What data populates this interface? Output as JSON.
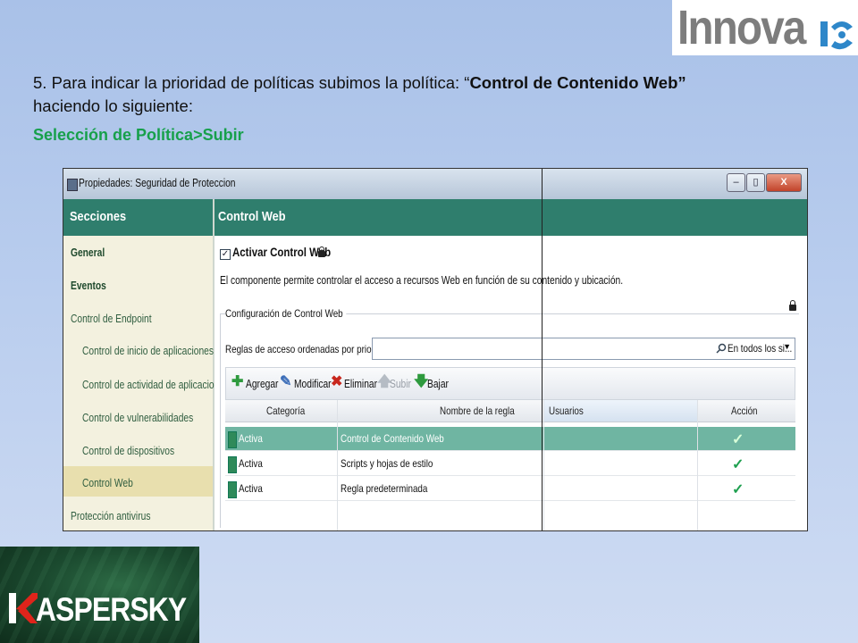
{
  "logo": {
    "text": "Innova"
  },
  "slide": {
    "intro": "5. Para indicar la prioridad de políticas subimos la política: “",
    "policy_name": "Control de Contenido Web",
    "intro_end": "”",
    "intro_line2": "haciendo lo siguiente:",
    "path": "Selección de Política>Subir"
  },
  "window": {
    "title": "Propiedades: Seguridad de Proteccion",
    "buttons": {
      "minimize": "–",
      "maximize": "▯",
      "close": "X"
    }
  },
  "sections": {
    "header": "Secciones",
    "items": [
      {
        "label": "General"
      },
      {
        "label": "Eventos"
      },
      {
        "label": "Control de Endpoint"
      },
      {
        "label": "Control de inicio de aplicaciones"
      },
      {
        "label": "Control de actividad de aplicaciones"
      },
      {
        "label": "Control de vulnerabilidades"
      },
      {
        "label": "Control de dispositivos"
      },
      {
        "label": "Control Web"
      },
      {
        "label": "Protección antivirus"
      }
    ],
    "selected": "Control Web"
  },
  "panel": {
    "header": "Control Web",
    "activate_label": "Activar Control Web",
    "activate_checked": true,
    "description": "El componente permite controlar el acceso a recursos Web en función de su contenido y ubicación.",
    "group_title": "Configuración de Control Web",
    "rules_label": "Reglas de acceso ordenadas por prioridad:",
    "search_scope": "En todos los si...",
    "toolbar": {
      "add": "Agregar",
      "edit": "Modificar",
      "delete": "Eliminar",
      "up": "Subir",
      "down": "Bajar"
    },
    "columns": [
      "Categoría",
      "Nombre de la regla",
      "Usuarios",
      "Acción"
    ],
    "rows": [
      {
        "status": "Activa",
        "name": "Control de Contenido Web",
        "users": "",
        "action": "✓",
        "selected": true
      },
      {
        "status": "Activa",
        "name": "Scripts y hojas de estilo",
        "users": "",
        "action": "✓",
        "selected": false
      },
      {
        "status": "Activa",
        "name": "Regla predeterminada",
        "users": "",
        "action": "✓",
        "selected": false
      }
    ]
  },
  "brand": {
    "text": "ASPERSKY",
    "accent": "#e0241b"
  },
  "colors": {
    "header_green": "#2f7e6d",
    "selected_row": "#6fb5a2",
    "path_green": "#17a04b"
  }
}
